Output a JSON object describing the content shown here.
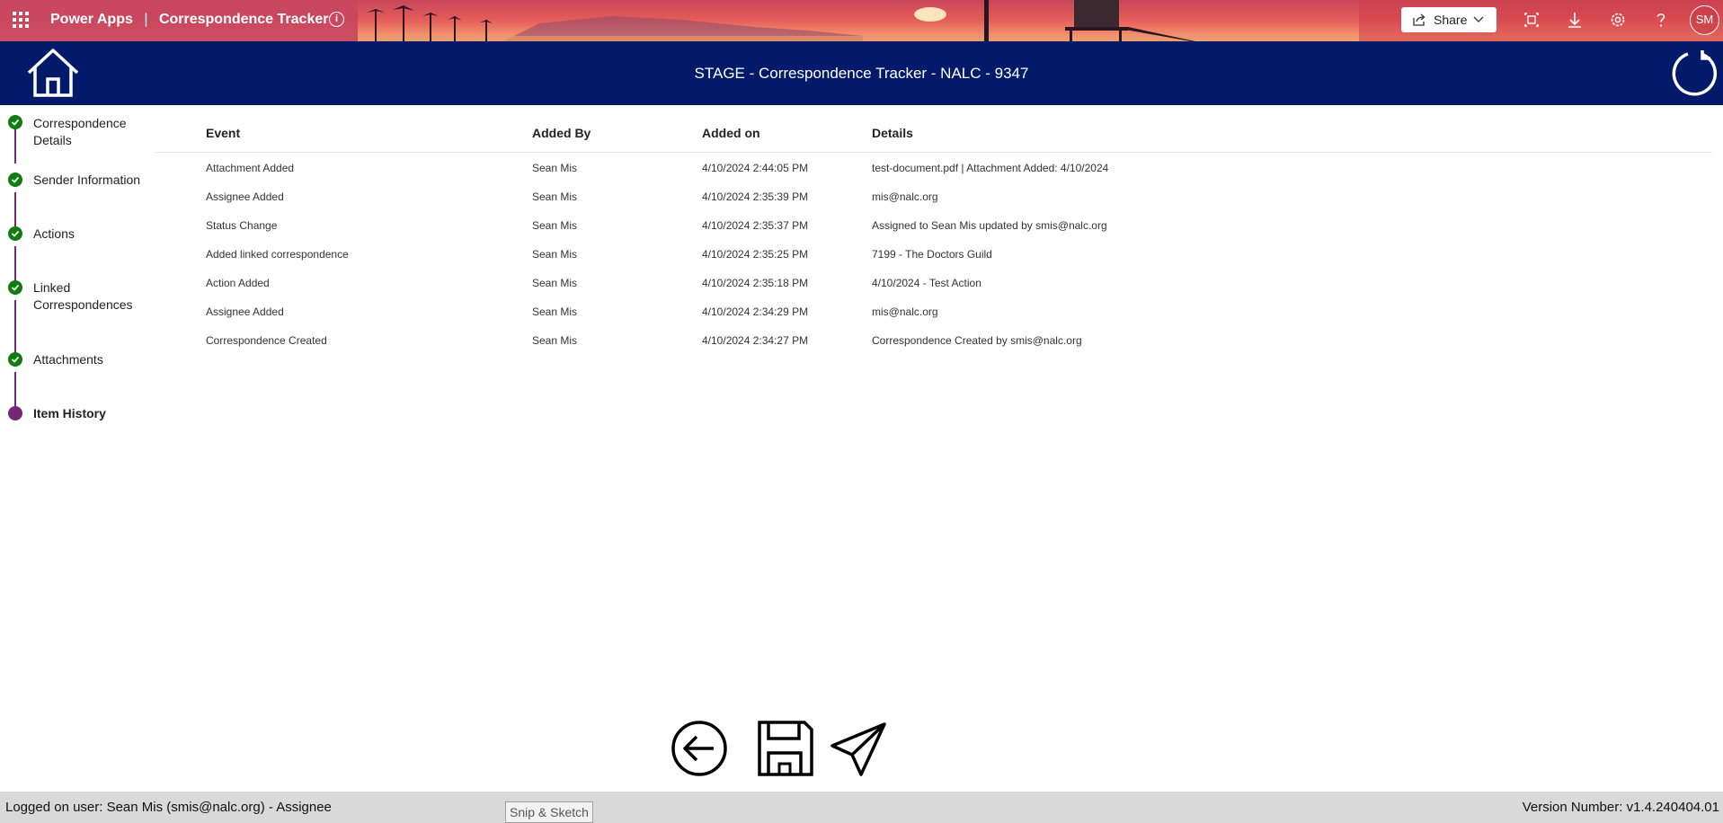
{
  "topbar": {
    "product": "Power Apps",
    "separator": "|",
    "app_name": "Correspondence Tracker",
    "share_label": "Share",
    "user_initials": "SM",
    "icons": [
      "waffle-icon",
      "info-icon",
      "share-icon",
      "chevron-down-icon",
      "fit-to-screen-icon",
      "download-icon",
      "settings-icon",
      "help-icon"
    ]
  },
  "header": {
    "title": "STAGE - Correspondence Tracker  - NALC - 9347",
    "icons": [
      "home-icon",
      "refresh-icon"
    ],
    "background": "#031a6b"
  },
  "steps": [
    {
      "label": "Correspondence Details",
      "status": "complete"
    },
    {
      "label": "Sender Information",
      "status": "complete"
    },
    {
      "label": "Actions",
      "status": "complete"
    },
    {
      "label": "Linked Correspondences",
      "status": "complete"
    },
    {
      "label": "Attachments",
      "status": "complete"
    },
    {
      "label": "Item History",
      "status": "current"
    }
  ],
  "history": {
    "columns": [
      "Event",
      "Added By",
      "Added on",
      "Details"
    ],
    "rows": [
      [
        "Attachment Added",
        "Sean Mis",
        "4/10/2024 2:44:05 PM",
        "test-document.pdf | Attachment Added: 4/10/2024"
      ],
      [
        "Assignee Added",
        "Sean Mis",
        "4/10/2024 2:35:39 PM",
        "mis@nalc.org"
      ],
      [
        "Status Change",
        "Sean Mis",
        "4/10/2024 2:35:37 PM",
        "Assigned to Sean Mis updated by smis@nalc.org"
      ],
      [
        "Added linked correspondence",
        "Sean Mis",
        "4/10/2024 2:35:25 PM",
        "7199 - The Doctors Guild"
      ],
      [
        "Action Added",
        "Sean Mis",
        "4/10/2024 2:35:18 PM",
        "4/10/2024 - Test Action"
      ],
      [
        "Assignee Added",
        "Sean Mis",
        "4/10/2024 2:34:29 PM",
        "mis@nalc.org"
      ],
      [
        "Correspondence Created",
        "Sean Mis",
        "4/10/2024 2:34:27 PM",
        "Correspondence Created by smis@nalc.org"
      ]
    ]
  },
  "actions": {
    "icons": [
      "back-arrow-icon",
      "save-icon",
      "send-icon"
    ]
  },
  "footer": {
    "user": "Logged on user: Sean Mis (smis@nalc.org) - Assignee",
    "version": "Version Number: v1.4.240404.01"
  },
  "tooltip": "Snip & Sketch",
  "colors": {
    "step_complete": "#107c10",
    "step_current": "#742774",
    "connector": "#742774",
    "footer_bg": "#d9d9d9"
  }
}
